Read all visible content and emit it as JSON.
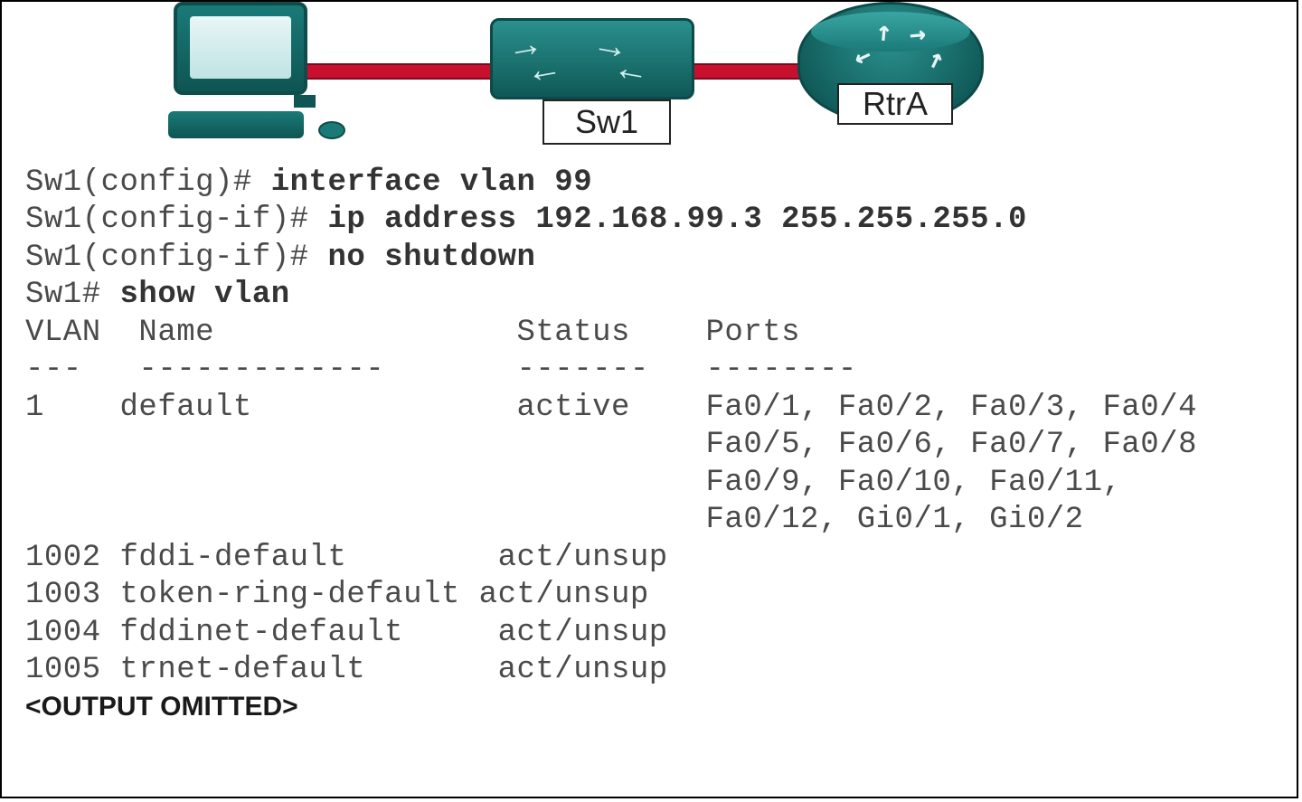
{
  "topology": {
    "pc": {
      "name": "PC"
    },
    "switch": {
      "label": "Sw1"
    },
    "router": {
      "label": "RtrA"
    }
  },
  "cli": {
    "p1": "Sw1(config)#",
    "c1": " interface vlan 99",
    "p2": "Sw1(config-if)#",
    "c2": " ip address 192.168.99.3 255.255.255.0",
    "p3": "Sw1(config-if)#",
    "c3": " no shutdown",
    "p4": "Sw1#",
    "c4": " show vlan",
    "hdr": "VLAN  Name                Status    Ports",
    "sep": "---   -------------       -------   --------",
    "r1a": "1    default              active    Fa0/1, Fa0/2, Fa0/3, Fa0/4",
    "r1b": "                                    Fa0/5, Fa0/6, Fa0/7, Fa0/8",
    "r1c": "                                    Fa0/9, Fa0/10, Fa0/11,",
    "r1d": "                                    Fa0/12, Gi0/1, Gi0/2",
    "r2": "1002 fddi-default        act/unsup",
    "r3": "1003 token-ring-default act/unsup",
    "r4": "1004 fddinet-default     act/unsup",
    "r5": "1005 trnet-default       act/unsup",
    "omit": "<OUTPUT OMITTED>"
  },
  "vlan_table": {
    "columns": [
      "VLAN",
      "Name",
      "Status",
      "Ports"
    ],
    "rows": [
      {
        "vlan": 1,
        "name": "default",
        "status": "active",
        "ports": [
          "Fa0/1",
          "Fa0/2",
          "Fa0/3",
          "Fa0/4",
          "Fa0/5",
          "Fa0/6",
          "Fa0/7",
          "Fa0/8",
          "Fa0/9",
          "Fa0/10",
          "Fa0/11",
          "Fa0/12",
          "Gi0/1",
          "Gi0/2"
        ]
      },
      {
        "vlan": 1002,
        "name": "fddi-default",
        "status": "act/unsup",
        "ports": []
      },
      {
        "vlan": 1003,
        "name": "token-ring-default",
        "status": "act/unsup",
        "ports": []
      },
      {
        "vlan": 1004,
        "name": "fddinet-default",
        "status": "act/unsup",
        "ports": []
      },
      {
        "vlan": 1005,
        "name": "trnet-default",
        "status": "act/unsup",
        "ports": []
      }
    ]
  },
  "config": {
    "interface": "vlan 99",
    "ip": "192.168.99.3",
    "mask": "255.255.255.0",
    "shutdown": false
  }
}
